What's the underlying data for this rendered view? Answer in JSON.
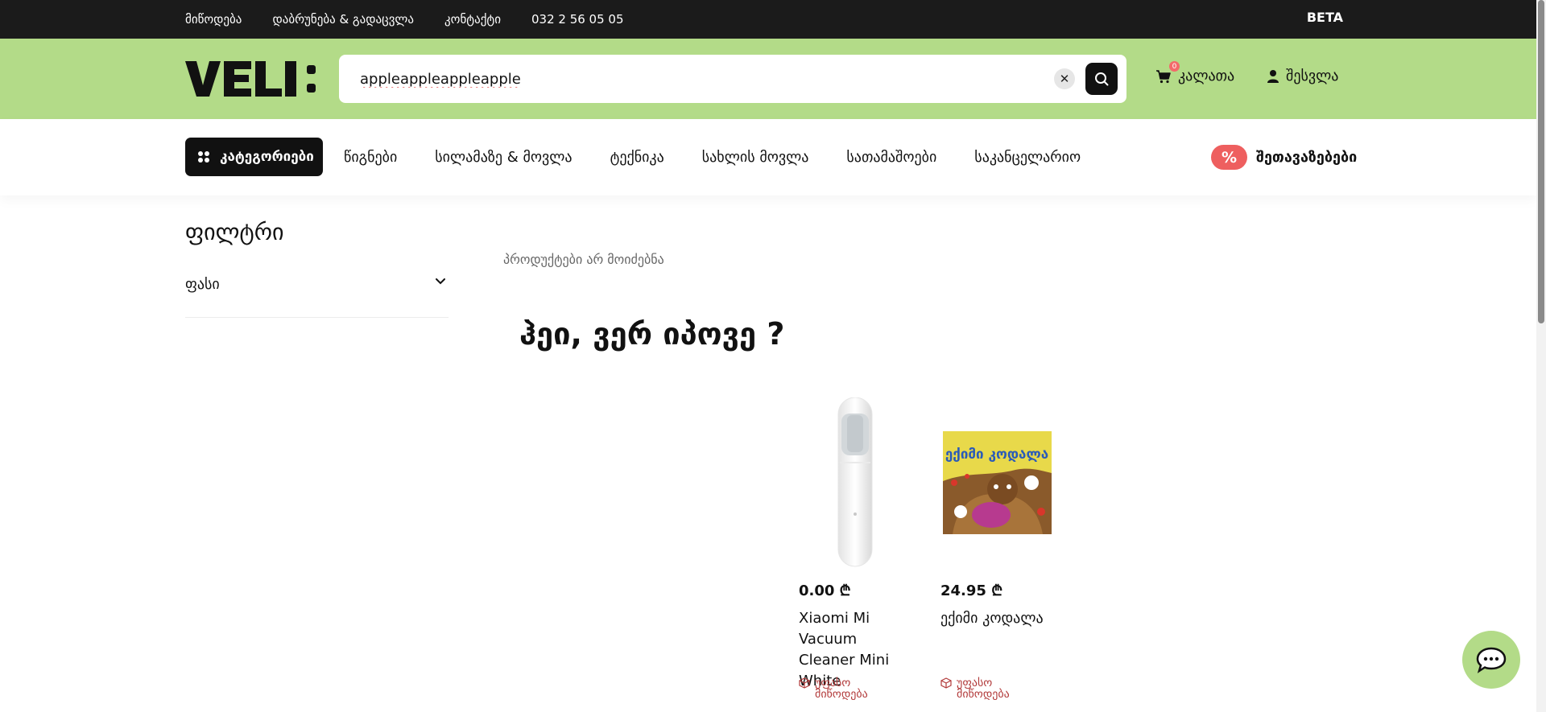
{
  "topbar": {
    "links": [
      "მიწოდება",
      "დაბრუნება & გადაცვლა",
      "კონტაქტი",
      "032 2 56 05 05"
    ],
    "badge": "BETA"
  },
  "header": {
    "logo_text": "VELI:",
    "search": {
      "value": "appleappleappleapple",
      "clear_icon": "close-icon",
      "submit_icon": "search-icon"
    },
    "cart": {
      "label": "კალათა",
      "count": "0"
    },
    "login": {
      "label": "შესვლა"
    }
  },
  "nav": {
    "categories_label": "კატეგორიები",
    "items": [
      "წიგნები",
      "სილამაზე & მოვლა",
      "ტექნიკა",
      "სახლის მოვლა",
      "სათამაშოები",
      "საკანცელარიო"
    ],
    "promo": {
      "icon": "%",
      "label": "შეთავაზებები"
    }
  },
  "filter": {
    "title": "ფილტრი",
    "rows": [
      {
        "label": "ფასი"
      }
    ]
  },
  "results": {
    "empty_text": "პროდუქტები არ მოიძებნა",
    "heading": "ჰეი, ვერ იპოვე ?"
  },
  "products": [
    {
      "price": "0.00 ₾",
      "name": "Xiaomi Mi Vacuum Cleaner Mini White",
      "shipping": "უფასო მიწოდება"
    },
    {
      "price": "24.95 ₾",
      "name": "ექიმი კოდალა",
      "shipping": "უფასო მიწოდება",
      "cover_text": "ექიმი კოდალა"
    }
  ],
  "colors": {
    "header_bg": "#b3db88",
    "topbar_bg": "#1b1b1b",
    "accent_red": "#ee5f5f"
  }
}
